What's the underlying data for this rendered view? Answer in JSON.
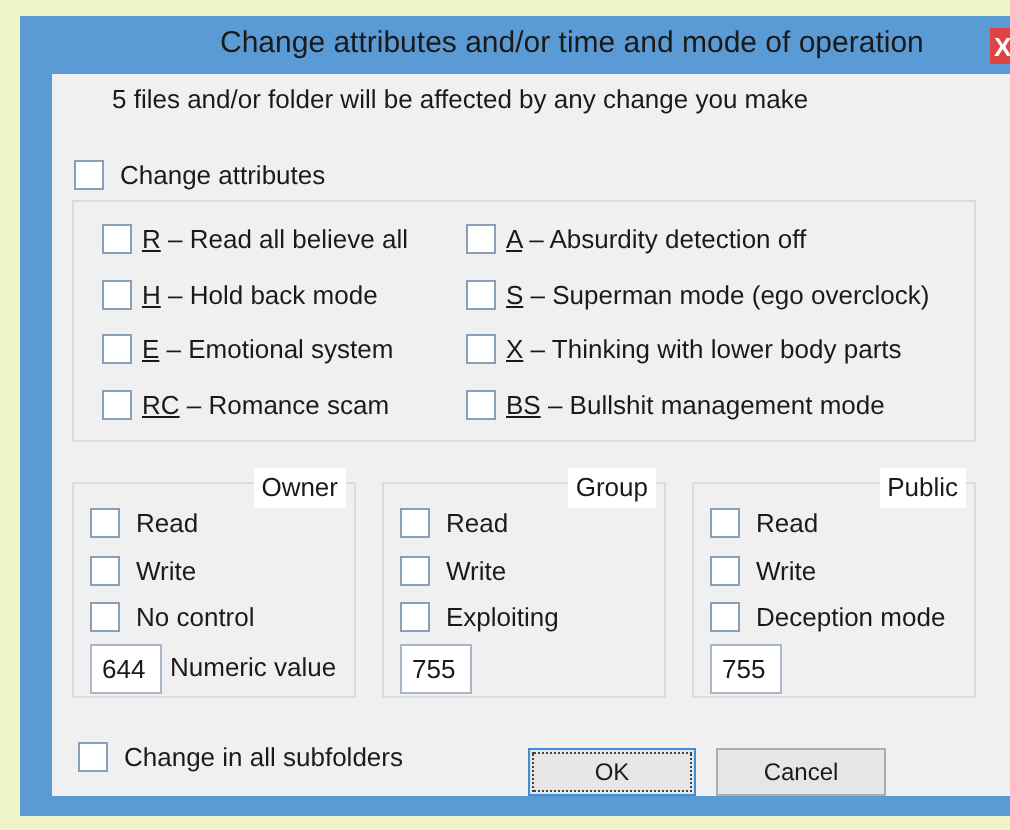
{
  "window": {
    "title": "Change attributes and/or time and mode of operation",
    "close": "X"
  },
  "info": "5 files and/or  folder will be affected by any change you make",
  "change_attributes": {
    "label": "Change attributes",
    "checked": false
  },
  "attributes": [
    {
      "key": "R",
      "label": "– Read all believe all",
      "checked": false
    },
    {
      "key": "A",
      "label": "– Absurdity detection off",
      "checked": false
    },
    {
      "key": "H",
      "label": "– Hold back mode",
      "checked": false
    },
    {
      "key": "S",
      "label": "– Superman mode (ego overclock)",
      "checked": false
    },
    {
      "key": "E",
      "label": "– Emotional system",
      "checked": false
    },
    {
      "key": "X",
      "label": "– Thinking with lower body parts",
      "checked": false
    },
    {
      "key": "RC",
      "label": "– Romance scam",
      "checked": false
    },
    {
      "key": "BS",
      "label": "– Bullshit management mode",
      "checked": false
    }
  ],
  "groups": [
    {
      "title": "Owner",
      "options": [
        {
          "label": "Read",
          "checked": false
        },
        {
          "label": "Write",
          "checked": false
        },
        {
          "label": "No control",
          "checked": false
        }
      ],
      "value": "644",
      "value_label": "Numeric value"
    },
    {
      "title": "Group",
      "options": [
        {
          "label": "Read",
          "checked": false
        },
        {
          "label": "Write",
          "checked": false
        },
        {
          "label": "Exploiting",
          "checked": false
        }
      ],
      "value": "755"
    },
    {
      "title": "Public",
      "options": [
        {
          "label": "Read",
          "checked": false
        },
        {
          "label": "Write",
          "checked": false
        },
        {
          "label": "Deception mode",
          "checked": false
        }
      ],
      "value": "755"
    }
  ],
  "subfolders": {
    "label": "Change in all subfolders",
    "checked": false
  },
  "buttons": [
    "OK",
    "Cancel"
  ]
}
